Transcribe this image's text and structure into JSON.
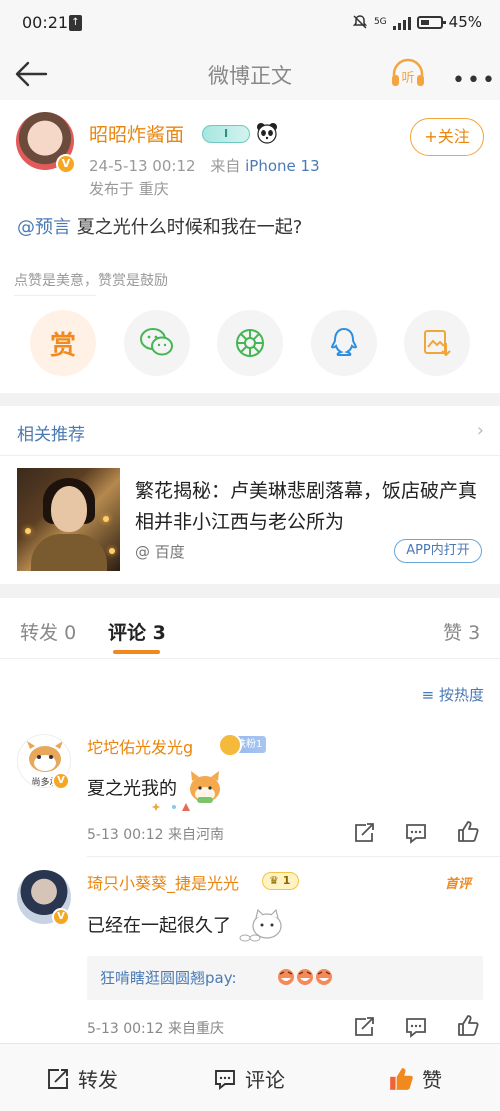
{
  "status_bar": {
    "time": "00:21",
    "network": "5G",
    "battery": "45%"
  },
  "nav": {
    "title": "微博正文",
    "listen_label": "听"
  },
  "post": {
    "author": "昭昭炸酱面",
    "level_badge": "I",
    "verified_badge": "V",
    "time": "24-5-13 00:12",
    "from_prefix": "来自",
    "device": "iPhone 13",
    "location": "发布于 重庆",
    "follow_label": "+关注",
    "mention": "@预言",
    "text": " 夏之光什么时候和我在一起?",
    "reward_tip": "点赞是美意，赞赏是鼓励",
    "reward_label": "赏"
  },
  "related": {
    "header": "相关推荐",
    "title": "繁花揭秘：卢美琳悲剧落幕，饭店破产真相并非小江西与老公所为",
    "source": "@ 百度",
    "app_open": "APP内打开"
  },
  "comments": {
    "tabs": [
      {
        "label": "转发",
        "count": "0"
      },
      {
        "label": "评论",
        "count": "3"
      },
      {
        "label": "赞",
        "count": "3"
      }
    ],
    "sort_label": "按热度",
    "items": [
      {
        "name": "坨坨佑光发光g",
        "fan_badge": "铁粉1",
        "text": "夏之光我的",
        "meta": "5-13 00:12  来自河南",
        "avatar_caption": "尚多承"
      },
      {
        "name": "琦只小葵葵_捷是光光",
        "level_badge": "1",
        "top_label": "首评",
        "text": "已经在一起很久了",
        "reply": "狂啃瞎逛圆圆翘pay:",
        "meta": "5-13 00:12  来自重庆"
      }
    ]
  },
  "toolbar": {
    "repost": "转发",
    "comment": "评论",
    "like": "赞"
  },
  "colors": {
    "accent_orange": "#e8860f",
    "link_blue": "#4a7ab5"
  }
}
